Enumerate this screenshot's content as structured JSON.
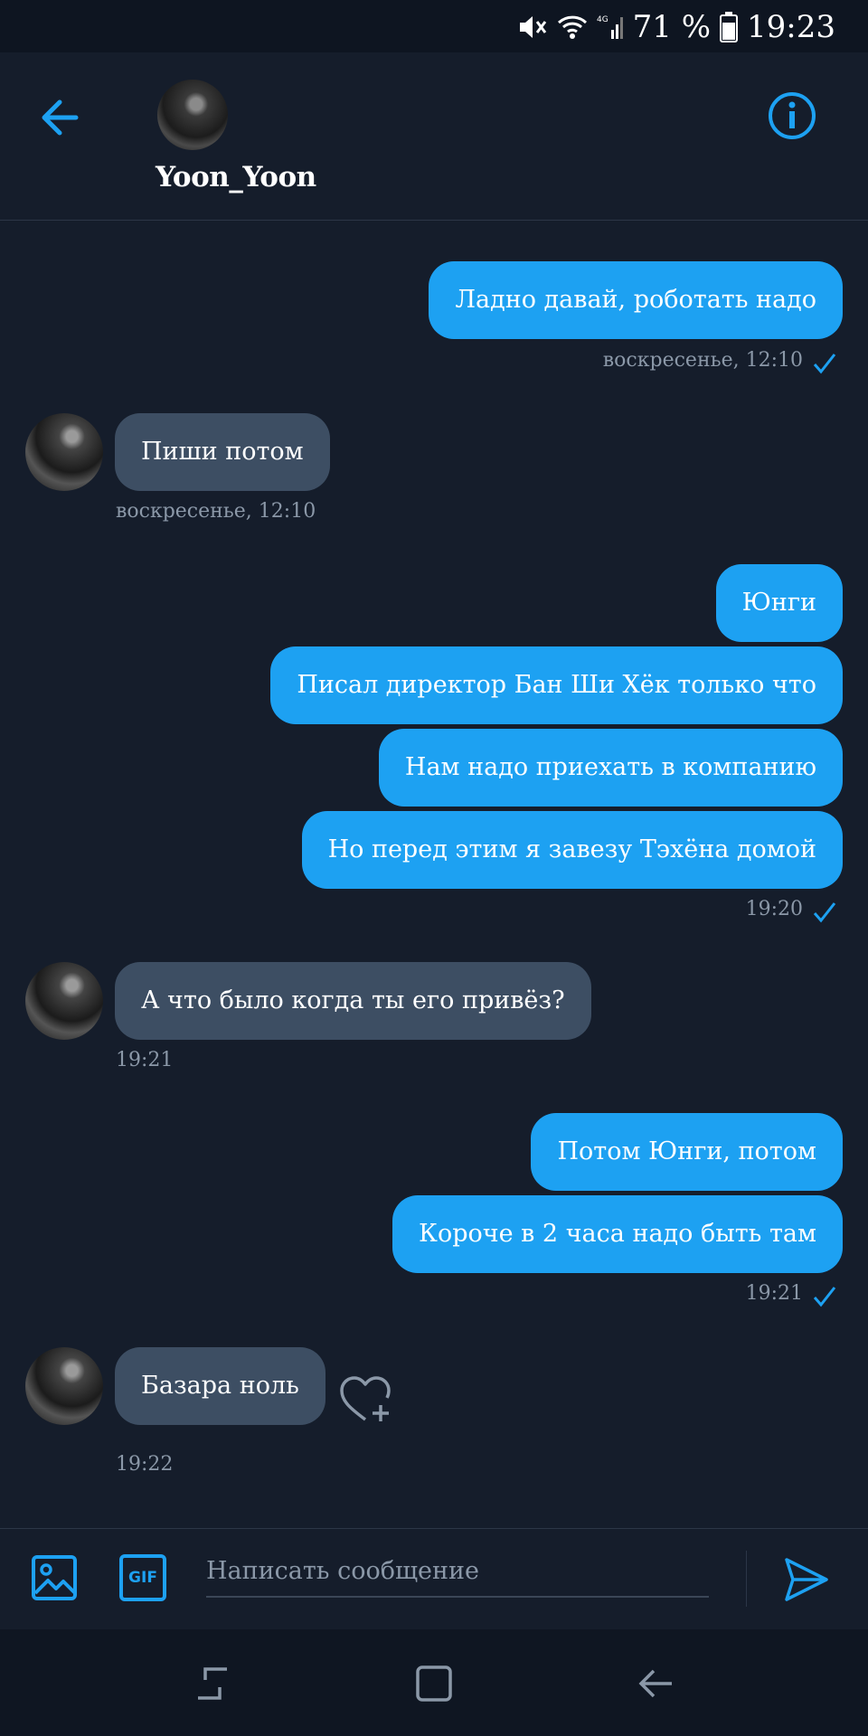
{
  "status_bar": {
    "battery_percent": "71 %",
    "time": "19:23"
  },
  "header": {
    "contact_name": "Yoon_Yoon"
  },
  "messages": [
    {
      "text": "Ладно давай, роботать надо"
    },
    {
      "text": "Пиши потом"
    },
    {
      "text": "Юнги"
    },
    {
      "text": "Писал директор Бан Ши Хёк только что"
    },
    {
      "text": "Нам надо приехать в компанию"
    },
    {
      "text": "Но перед этим я завезу Тэхёна домой"
    },
    {
      "text": "А что было когда ты его привёз?"
    },
    {
      "text": "Потом Юнги, потом"
    },
    {
      "text": "Короче в 2 часа надо быть там"
    },
    {
      "text": "Базара ноль"
    }
  ],
  "timestamps": [
    "воскресенье, 12:10",
    "воскресенье, 12:10",
    "19:20",
    "19:21",
    "19:21",
    "19:22"
  ],
  "composer": {
    "placeholder": "Написать сообщение",
    "gif_label": "GIF"
  },
  "colors": {
    "background": "#151d2b",
    "outgoing_bubble": "#1da1f2",
    "incoming_bubble": "#3d4e63",
    "accent": "#1da1f2",
    "meta_text": "#8b98a8"
  },
  "icons": {
    "header": [
      "back-arrow-icon",
      "info-icon"
    ],
    "status": [
      "mute-icon",
      "wifi-icon",
      "signal-icon",
      "battery-icon"
    ],
    "composer": [
      "image-icon",
      "gif-icon",
      "send-icon"
    ],
    "navigation": [
      "recent-apps-icon",
      "home-icon",
      "back-icon"
    ],
    "message": [
      "read-check-icon",
      "heart-plus-icon"
    ]
  }
}
